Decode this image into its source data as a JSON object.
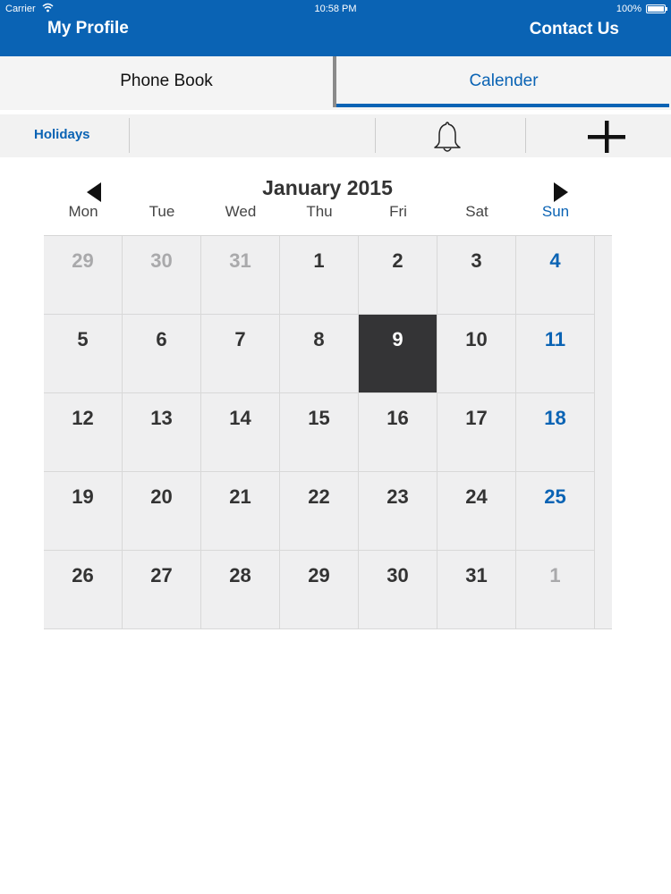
{
  "status_bar": {
    "carrier": "Carrier",
    "time": "10:58 PM",
    "battery": "100%"
  },
  "nav": {
    "left_label": "My Profile",
    "right_label": "Contact Us"
  },
  "tabs": [
    {
      "label": "Phone Book",
      "selected": false
    },
    {
      "label": "Calender",
      "selected": true
    }
  ],
  "toolbar": {
    "holidays_label": "Holidays",
    "bell_icon": "bell-icon",
    "add_icon": "plus-icon"
  },
  "calendar": {
    "month_title": "January 2015",
    "weekdays": [
      "Mon",
      "Tue",
      "Wed",
      "Thu",
      "Fri",
      "Sat",
      "Sun"
    ],
    "selected_day": "9",
    "weeks": [
      [
        {
          "day": "29",
          "current": false
        },
        {
          "day": "30",
          "current": false
        },
        {
          "day": "31",
          "current": false
        },
        {
          "day": "1",
          "current": true
        },
        {
          "day": "2",
          "current": true
        },
        {
          "day": "3",
          "current": true
        },
        {
          "day": "4",
          "current": true
        }
      ],
      [
        {
          "day": "5",
          "current": true
        },
        {
          "day": "6",
          "current": true
        },
        {
          "day": "7",
          "current": true
        },
        {
          "day": "8",
          "current": true
        },
        {
          "day": "9",
          "current": true
        },
        {
          "day": "10",
          "current": true
        },
        {
          "day": "11",
          "current": true
        }
      ],
      [
        {
          "day": "12",
          "current": true
        },
        {
          "day": "13",
          "current": true
        },
        {
          "day": "14",
          "current": true
        },
        {
          "day": "15",
          "current": true
        },
        {
          "day": "16",
          "current": true
        },
        {
          "day": "17",
          "current": true
        },
        {
          "day": "18",
          "current": true
        }
      ],
      [
        {
          "day": "19",
          "current": true
        },
        {
          "day": "20",
          "current": true
        },
        {
          "day": "21",
          "current": true
        },
        {
          "day": "22",
          "current": true
        },
        {
          "day": "23",
          "current": true
        },
        {
          "day": "24",
          "current": true
        },
        {
          "day": "25",
          "current": true
        }
      ],
      [
        {
          "day": "26",
          "current": true
        },
        {
          "day": "27",
          "current": true
        },
        {
          "day": "28",
          "current": true
        },
        {
          "day": "29",
          "current": true
        },
        {
          "day": "30",
          "current": true
        },
        {
          "day": "31",
          "current": true
        },
        {
          "day": "1",
          "current": false
        }
      ]
    ]
  },
  "colors": {
    "brand": "#0a63b4",
    "selected_bg": "#343436",
    "grid_bg": "#efeff0",
    "muted_text": "#a9a9ab"
  }
}
